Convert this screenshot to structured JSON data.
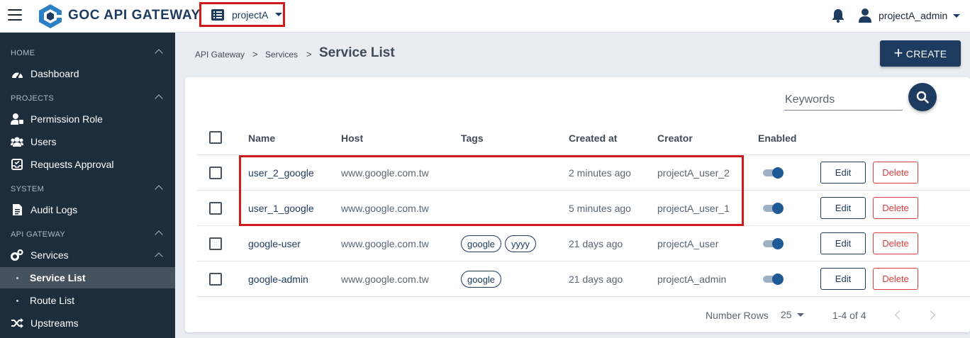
{
  "app": {
    "brand": "GOC API GATEWAY"
  },
  "project_select": {
    "value": "projectA"
  },
  "user": {
    "name": "projectA_admin"
  },
  "sidebar": {
    "sections": [
      {
        "label": "HOME"
      },
      {
        "label": "PROJECTS"
      },
      {
        "label": "SYSTEM"
      },
      {
        "label": "API GATEWAY"
      }
    ],
    "items": {
      "dashboard": "Dashboard",
      "permission_role": "Permission Role",
      "users": "Users",
      "requests_approval": "Requests Approval",
      "audit_logs": "Audit Logs",
      "services": "Services",
      "service_list": "Service List",
      "route_list": "Route List",
      "upstreams": "Upstreams"
    }
  },
  "breadcrumb": {
    "root": "API Gateway",
    "parent": "Services",
    "sep": ">",
    "current": "Service List"
  },
  "create_button": {
    "label": "CREATE"
  },
  "search": {
    "placeholder": "Keywords"
  },
  "table": {
    "headers": {
      "name": "Name",
      "host": "Host",
      "tags": "Tags",
      "created_at": "Created at",
      "creator": "Creator",
      "enabled": "Enabled"
    },
    "edit_label": "Edit",
    "delete_label": "Delete",
    "rows": [
      {
        "name": "user_2_google",
        "host": "www.google.com.tw",
        "tags": [],
        "created_at": "2 minutes ago",
        "creator": "projectA_user_2",
        "enabled": true
      },
      {
        "name": "user_1_google",
        "host": "www.google.com.tw",
        "tags": [],
        "created_at": "5 minutes ago",
        "creator": "projectA_user_1",
        "enabled": true
      },
      {
        "name": "google-user",
        "host": "www.google.com.tw",
        "tags": [
          "google",
          "yyyy"
        ],
        "created_at": "21 days ago",
        "creator": "projectA_user",
        "enabled": true
      },
      {
        "name": "google-admin",
        "host": "www.google.com.tw",
        "tags": [
          "google"
        ],
        "created_at": "21 days ago",
        "creator": "projectA_admin",
        "enabled": true
      }
    ]
  },
  "pagination": {
    "rows_label": "Number Rows",
    "rows_value": "25",
    "range": "1-4 of 4"
  },
  "colors": {
    "primary": "#1d3a5f",
    "sidebar_bg": "#1d2d3c",
    "danger": "#d6403e",
    "highlight": "#d11a1a"
  }
}
